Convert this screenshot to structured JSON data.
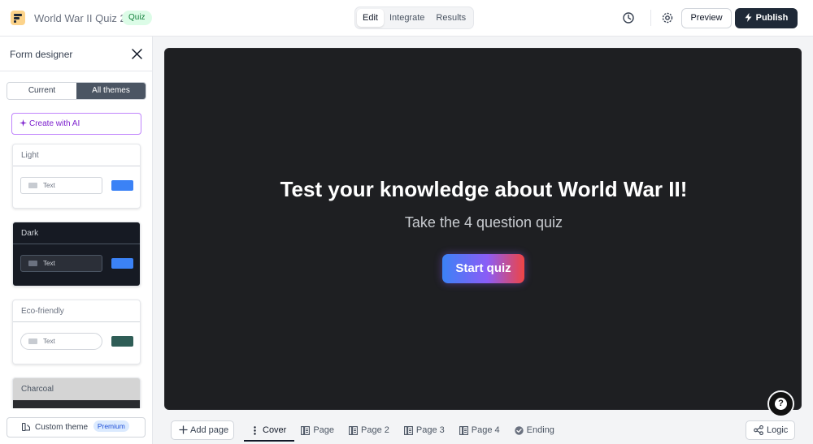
{
  "header": {
    "title": "World War II Quiz 2",
    "badge": "Quiz",
    "tabs": [
      {
        "label": "Edit",
        "active": true
      },
      {
        "label": "Integrate",
        "active": false
      },
      {
        "label": "Results",
        "active": false
      }
    ],
    "preview_label": "Preview",
    "publish_label": "Publish"
  },
  "sidebar": {
    "title": "Form designer",
    "tabs": [
      {
        "label": "Current",
        "active": false
      },
      {
        "label": "All themes",
        "active": true
      }
    ],
    "create_ai_label": "Create with AI",
    "themes": [
      {
        "name": "Light",
        "input_text": "Text",
        "bg": "#ffffff",
        "fg": "#6b7280",
        "input_bg": "#ffffff",
        "input_border": "#d1d5db",
        "button": "#3b82f6"
      },
      {
        "name": "Dark",
        "input_text": "Text",
        "bg": "#161a23",
        "fg": "#d1d5db",
        "input_bg": "#2b2f38",
        "input_border": "#4b5563",
        "button": "#3b82f6"
      },
      {
        "name": "Eco-friendly",
        "input_text": "Text",
        "bg": "#ffffff",
        "fg": "#6b7280",
        "input_bg": "#ffffff",
        "input_border": "#d1d5db",
        "button": "#2f5d56"
      },
      {
        "name": "Charcoal",
        "input_text": "",
        "bg": "#d4d4d4",
        "fg": "#4b5563",
        "input_bg": "#d4d4d4",
        "input_border": "#d4d4d4",
        "button": "#d4d4d4"
      }
    ],
    "custom_theme_label": "Custom theme",
    "premium_label": "Premium"
  },
  "canvas": {
    "title": "Test your knowledge about World War II!",
    "subtitle": "Take the 4 question quiz",
    "start_label": "Start quiz"
  },
  "bottom": {
    "add_page_label": "Add page",
    "pages": [
      {
        "label": "Cover",
        "icon": "more-vertical-icon",
        "active": true
      },
      {
        "label": "Page",
        "icon": "page-icon",
        "active": false
      },
      {
        "label": "Page 2",
        "icon": "page-icon",
        "active": false
      },
      {
        "label": "Page 3",
        "icon": "page-icon",
        "active": false
      },
      {
        "label": "Page 4",
        "icon": "page-icon",
        "active": false
      },
      {
        "label": "Ending",
        "icon": "check-circle-icon",
        "active": false
      }
    ],
    "logic_label": "Logic"
  }
}
